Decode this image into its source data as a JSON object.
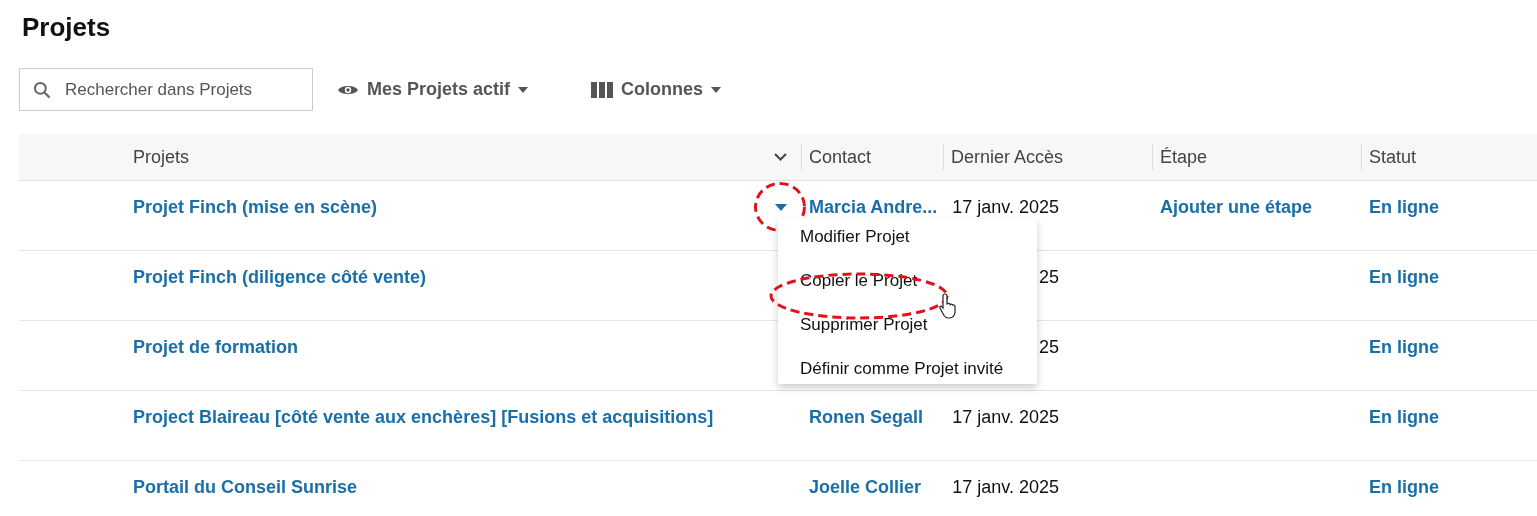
{
  "title": "Projets",
  "search": {
    "placeholder": "Rechercher dans Projets"
  },
  "filters": [
    {
      "kind": "view",
      "label": "Mes Projets actif"
    },
    {
      "kind": "columns",
      "label": "Colonnes"
    }
  ],
  "table": {
    "columns": [
      "Projets",
      "Contact",
      "Dernier Accès",
      "Étape",
      "Statut"
    ],
    "rows": [
      {
        "project": "Projet Finch (mise en scène)",
        "contact": "Marcia Andre...",
        "date": "17 janv. 2025",
        "stage": "Ajouter une étape",
        "status": "En ligne",
        "menu_open": true
      },
      {
        "project": "Projet Finch (diligence côté vente)",
        "date": "25",
        "status": "En ligne",
        "menu_open": false
      },
      {
        "project": "Projet de formation",
        "date": "25",
        "status": "En ligne",
        "menu_open": false
      },
      {
        "project": "Project Blaireau [côté vente aux enchères] [Fusions et acquisitions]",
        "contact": "Ronen Segall",
        "date": "17 janv. 2025",
        "status": "En ligne",
        "menu_open": false
      },
      {
        "project": "Portail du Conseil Sunrise",
        "contact": "Joelle Collier",
        "date": "17 janv. 2025",
        "status": "En ligne",
        "menu_open": false
      }
    ]
  },
  "row_menu": {
    "items": [
      {
        "label": "Modifier Projet",
        "circled": false
      },
      {
        "label": "Copier le Projet",
        "circled": true
      },
      {
        "label": "Supprimer Projet",
        "circled": false
      },
      {
        "label": "Définir comme Projet invité",
        "circled": false
      }
    ]
  }
}
